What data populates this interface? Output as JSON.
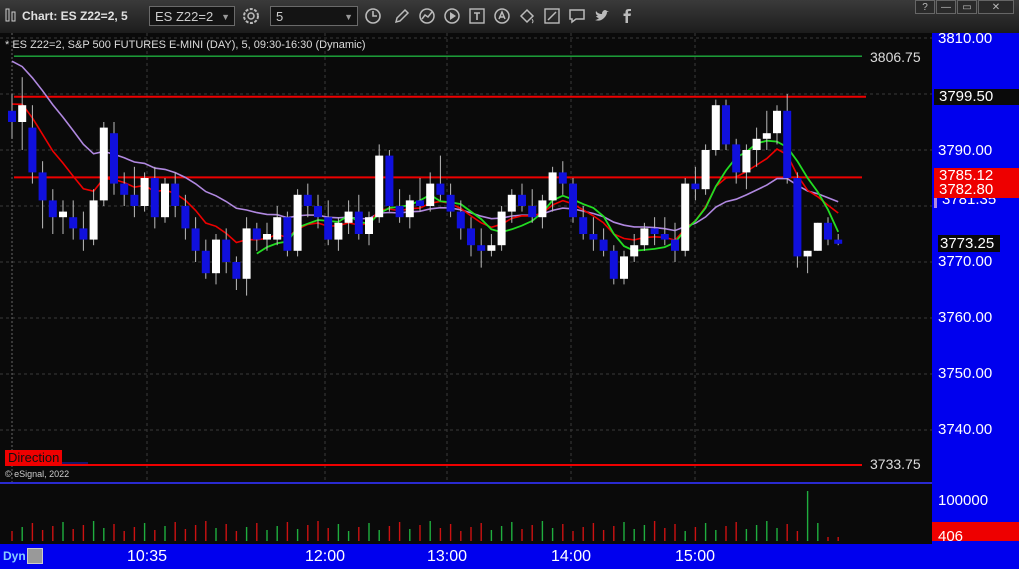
{
  "window": {
    "title": "Chart: ES Z22=2, 5"
  },
  "toolbar": {
    "symbol_value": "ES Z22=2",
    "interval_value": "5",
    "icons": [
      "settings-icon",
      "clock-icon",
      "pencil-icon",
      "chart-line-icon",
      "play-icon",
      "text-icon",
      "hand-icon",
      "paint-bucket-icon",
      "comment-icon",
      "twitter-icon",
      "facebook-icon"
    ]
  },
  "window_buttons": [
    "?",
    "—",
    "▭",
    "✕"
  ],
  "chart": {
    "header": "ES Z22=2, S&P 500 FUTURES E-MINI (DAY), 5, 09:30-16:30 (Dynamic)",
    "copyright": "© eSignal, 2022",
    "direction_label": "Direction",
    "price_labels": [
      "3810.00",
      "3790.00",
      "3780.00",
      "3770.00",
      "3760.00",
      "3750.00",
      "3740.00"
    ],
    "volume_label": "100000",
    "volume_value": "406",
    "current_price": "3773.25",
    "tags": [
      {
        "text": "3799.50"
      },
      {
        "text": "3785.12"
      },
      {
        "text": "3782.80"
      },
      {
        "text": "3781.35"
      }
    ],
    "levels": [
      {
        "text": "3806.75",
        "color": "#1fae3e"
      },
      {
        "text": "3733.75",
        "color": "#ff2020"
      }
    ],
    "colors": {
      "up": "#ffffff",
      "down": "#1010dd",
      "ema": "#ee0000",
      "sma_green": "#22dd22",
      "sma_purple": "#b088e0",
      "axis": "#0000ee"
    }
  },
  "bottom": {
    "dyn_label": "Dyn",
    "time_labels": [
      "10:35",
      "12:00",
      "13:00",
      "14:00",
      "15:00"
    ]
  },
  "chart_data": {
    "type": "candlestick",
    "title": "ES Z22=2, S&P 500 FUTURES E-MINI (DAY), 5, 09:30-16:30 (Dynamic)",
    "y_ticks": [
      3740,
      3750,
      3760,
      3770,
      3780,
      3790,
      3810
    ],
    "x_ticks": [
      "10:35",
      "12:00",
      "13:00",
      "14:00",
      "15:00"
    ],
    "ohlc": [
      [
        3797,
        3800,
        3792,
        3795
      ],
      [
        3795,
        3803,
        3790,
        3798
      ],
      [
        3794,
        3798,
        3784,
        3786
      ],
      [
        3786,
        3788,
        3776,
        3781
      ],
      [
        3781,
        3783,
        3775,
        3778
      ],
      [
        3778,
        3781,
        3775,
        3779
      ],
      [
        3778,
        3781,
        3774,
        3776
      ],
      [
        3776,
        3779,
        3772,
        3774
      ],
      [
        3774,
        3783,
        3773,
        3781
      ],
      [
        3781,
        3795,
        3780,
        3794
      ],
      [
        3793,
        3795,
        3782,
        3784
      ],
      [
        3784,
        3786,
        3780,
        3782
      ],
      [
        3782,
        3787,
        3778,
        3780
      ],
      [
        3780,
        3786,
        3779,
        3785
      ],
      [
        3785,
        3787,
        3776,
        3778
      ],
      [
        3778,
        3785,
        3777,
        3784
      ],
      [
        3784,
        3786,
        3778,
        3780
      ],
      [
        3780,
        3782,
        3774,
        3776
      ],
      [
        3776,
        3778,
        3770,
        3772
      ],
      [
        3772,
        3774,
        3767,
        3768
      ],
      [
        3768,
        3775,
        3766,
        3774
      ],
      [
        3774,
        3776,
        3768,
        3770
      ],
      [
        3770,
        3771,
        3765,
        3767
      ],
      [
        3767,
        3778,
        3764,
        3776
      ],
      [
        3776,
        3777,
        3772,
        3774
      ],
      [
        3774,
        3777,
        3772,
        3775
      ],
      [
        3774,
        3780,
        3773,
        3778
      ],
      [
        3778,
        3779,
        3771,
        3772
      ],
      [
        3772,
        3783,
        3771,
        3782
      ],
      [
        3782,
        3784,
        3778,
        3780
      ],
      [
        3780,
        3782,
        3776,
        3778
      ],
      [
        3778,
        3781,
        3773,
        3774
      ],
      [
        3774,
        3778,
        3772,
        3777
      ],
      [
        3777,
        3781,
        3775,
        3779
      ],
      [
        3779,
        3782,
        3774,
        3775
      ],
      [
        3775,
        3779,
        3773,
        3778
      ],
      [
        3778,
        3791,
        3777,
        3789
      ],
      [
        3789,
        3790,
        3779,
        3780
      ],
      [
        3780,
        3783,
        3777,
        3778
      ],
      [
        3778,
        3782,
        3776,
        3781
      ],
      [
        3781,
        3785,
        3779,
        3780
      ],
      [
        3780,
        3786,
        3779,
        3784
      ],
      [
        3784,
        3789,
        3781,
        3782
      ],
      [
        3782,
        3784,
        3778,
        3779
      ],
      [
        3779,
        3781,
        3774,
        3776
      ],
      [
        3776,
        3778,
        3771,
        3773
      ],
      [
        3773,
        3776,
        3769,
        3772
      ],
      [
        3772,
        3775,
        3771,
        3773
      ],
      [
        3773,
        3780,
        3772,
        3779
      ],
      [
        3779,
        3783,
        3777,
        3782
      ],
      [
        3782,
        3784,
        3779,
        3780
      ],
      [
        3780,
        3783,
        3777,
        3778
      ],
      [
        3778,
        3782,
        3776,
        3781
      ],
      [
        3781,
        3787,
        3779,
        3786
      ],
      [
        3786,
        3788,
        3782,
        3784
      ],
      [
        3784,
        3785,
        3777,
        3778
      ],
      [
        3778,
        3780,
        3774,
        3775
      ],
      [
        3775,
        3778,
        3772,
        3774
      ],
      [
        3774,
        3776,
        3771,
        3772
      ],
      [
        3772,
        3773,
        3766,
        3767
      ],
      [
        3767,
        3772,
        3766,
        3771
      ],
      [
        3771,
        3775,
        3770,
        3773
      ],
      [
        3773,
        3777,
        3772,
        3776
      ],
      [
        3776,
        3778,
        3773,
        3775
      ],
      [
        3775,
        3778,
        3773,
        3774
      ],
      [
        3774,
        3777,
        3770,
        3772
      ],
      [
        3772,
        3785,
        3771,
        3784
      ],
      [
        3784,
        3787,
        3781,
        3783
      ],
      [
        3783,
        3791,
        3782,
        3790
      ],
      [
        3790,
        3799,
        3789,
        3798
      ],
      [
        3798,
        3799,
        3790,
        3791
      ],
      [
        3791,
        3792,
        3784,
        3786
      ],
      [
        3786,
        3791,
        3783,
        3790
      ],
      [
        3790,
        3794,
        3787,
        3792
      ],
      [
        3792,
        3797,
        3790,
        3793
      ],
      [
        3793,
        3798,
        3791,
        3797
      ],
      [
        3797,
        3800,
        3784,
        3785
      ],
      [
        3785,
        3786,
        3769,
        3771
      ],
      [
        3771,
        3772,
        3768,
        3772
      ],
      [
        3772,
        3777,
        3772,
        3777
      ],
      [
        3777,
        3778,
        3773,
        3774
      ],
      [
        3774,
        3775,
        3773,
        3773.25
      ]
    ]
  }
}
